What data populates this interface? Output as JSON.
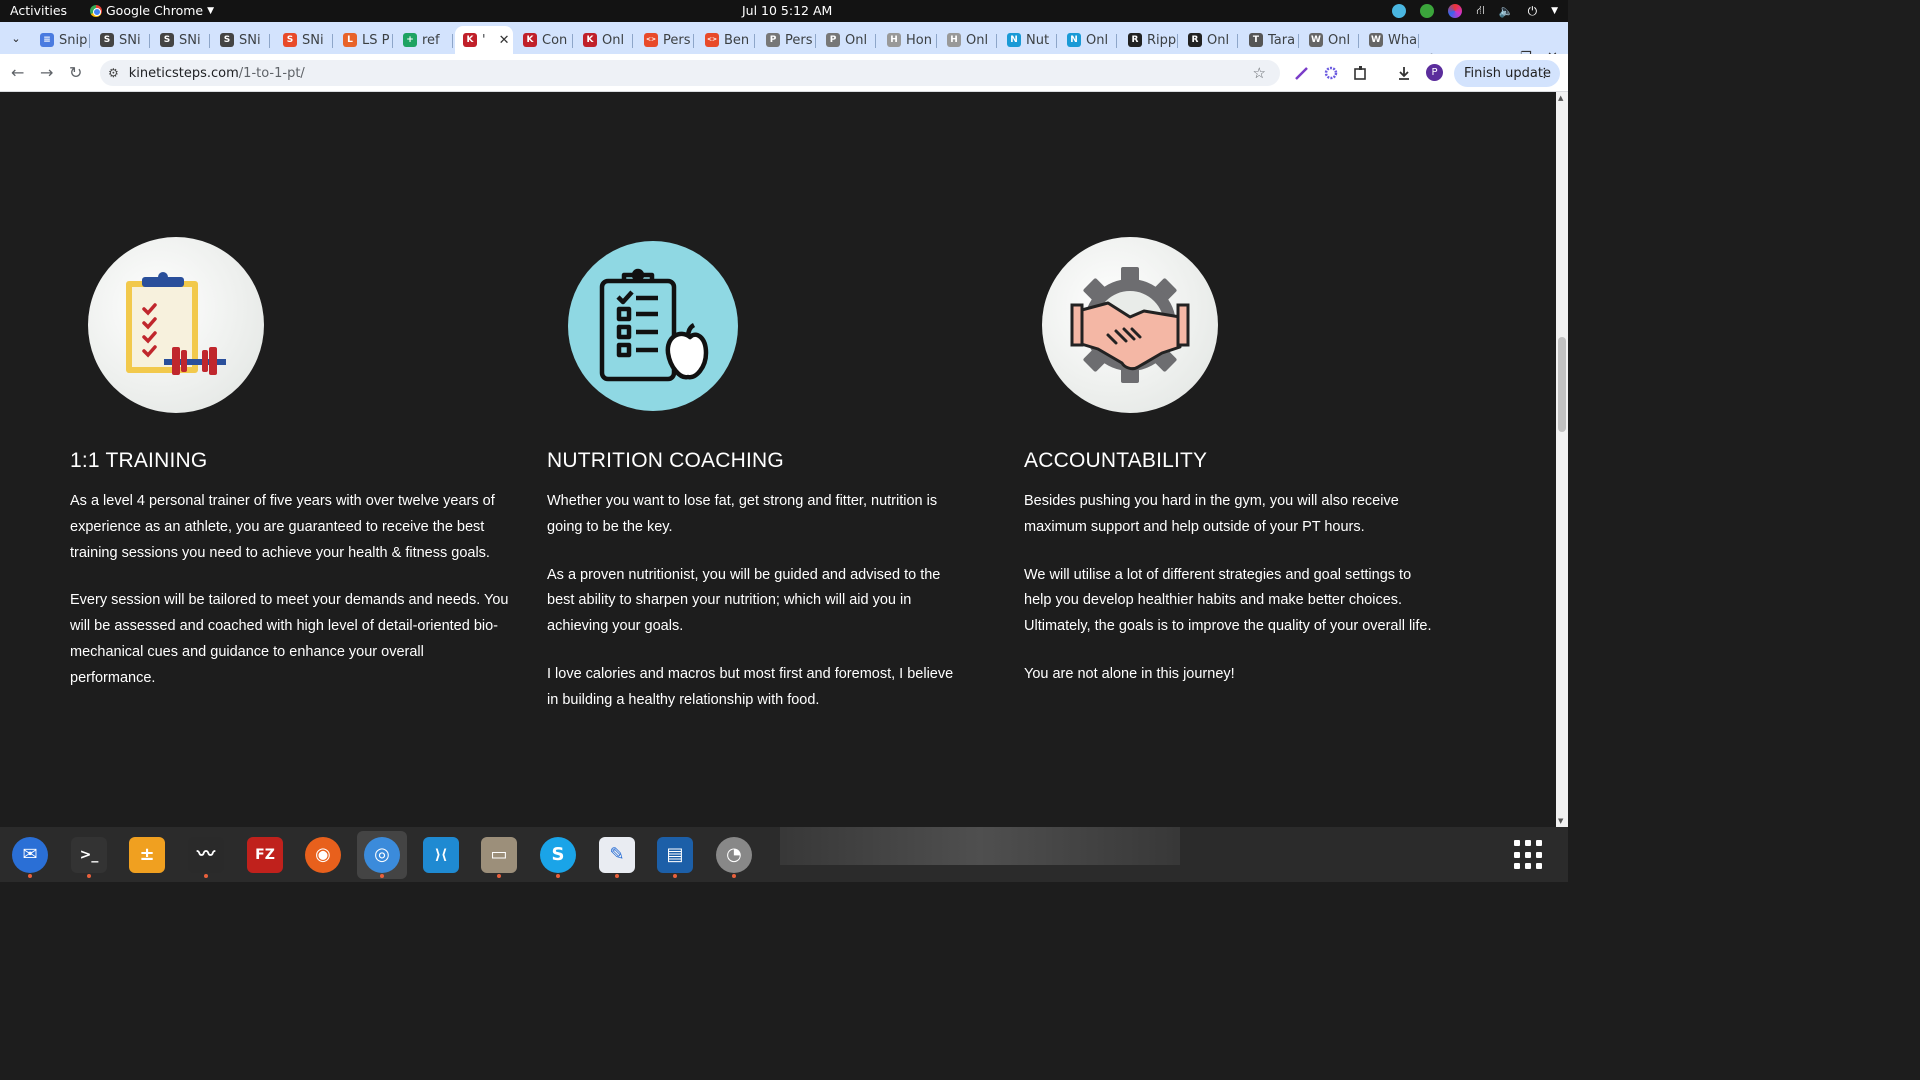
{
  "topbar": {
    "activities": "Activities",
    "app_name": "Google Chrome",
    "clock": "Jul 10  5:12 AM"
  },
  "tabs": [
    {
      "label": "Snip",
      "fav_color": "#4a7be0",
      "fav_glyph": "≡"
    },
    {
      "label": "SNi",
      "fav_color": "#444",
      "fav_glyph": "S"
    },
    {
      "label": "SNi",
      "fav_color": "#444",
      "fav_glyph": "S"
    },
    {
      "label": "SNi",
      "fav_color": "#444",
      "fav_glyph": "S"
    },
    {
      "label": "SNi",
      "fav_color": "#e84a2a",
      "fav_glyph": "S"
    },
    {
      "label": "LS P",
      "fav_color": "#e8632a",
      "fav_glyph": "L"
    },
    {
      "label": "ref",
      "fav_color": "#1ea362",
      "fav_glyph": "+"
    },
    {
      "label": "'",
      "fav_color": "#c0202a",
      "fav_glyph": "K",
      "active": true
    },
    {
      "label": "Con",
      "fav_color": "#c0202a",
      "fav_glyph": "K"
    },
    {
      "label": "Onl",
      "fav_color": "#c0202a",
      "fav_glyph": "K"
    },
    {
      "label": "Pers",
      "fav_color": "#e84a2a",
      "fav_glyph": "<>"
    },
    {
      "label": "Ben",
      "fav_color": "#e84a2a",
      "fav_glyph": "<>"
    },
    {
      "label": "Pers",
      "fav_color": "#777",
      "fav_glyph": "P"
    },
    {
      "label": "Onl",
      "fav_color": "#777",
      "fav_glyph": "P"
    },
    {
      "label": "Hon",
      "fav_color": "#999",
      "fav_glyph": "H"
    },
    {
      "label": "Onl",
      "fav_color": "#999",
      "fav_glyph": "H"
    },
    {
      "label": "Nut",
      "fav_color": "#1a9ad6",
      "fav_glyph": "N"
    },
    {
      "label": "Onl",
      "fav_color": "#1a9ad6",
      "fav_glyph": "N"
    },
    {
      "label": "Ripp",
      "fav_color": "#222",
      "fav_glyph": "R"
    },
    {
      "label": "Onl",
      "fav_color": "#222",
      "fav_glyph": "R"
    },
    {
      "label": "Tara",
      "fav_color": "#555",
      "fav_glyph": "T"
    },
    {
      "label": "Onl",
      "fav_color": "#666",
      "fav_glyph": "W"
    },
    {
      "label": "Wha",
      "fav_color": "#666",
      "fav_glyph": "W"
    }
  ],
  "toolbar": {
    "url_domain": "kineticsteps.com",
    "url_path": "/1-to-1-pt/",
    "finish_update": "Finish update",
    "avatar_letter": "P"
  },
  "features": [
    {
      "title": "1:1 TRAINING",
      "icon": "clipboard-dumbbell-icon",
      "paragraphs": [
        "As a level 4 personal trainer of five years with over twelve years of experience as an athlete, you are guaranteed to receive the best training sessions you need to achieve your health & fitness goals.",
        "Every session will be tailored to meet your demands and needs. You will be assessed and coached with high level of detail-oriented bio-mechanical cues and guidance to enhance your overall performance."
      ]
    },
    {
      "title": "NUTRITION COACHING",
      "icon": "checklist-apple-icon",
      "paragraphs": [
        "Whether you want to lose fat, get strong and fitter, nutrition is going to be the key.",
        "As a proven nutritionist, you will be guided and advised to the best ability to sharpen your nutrition; which will aid you in achieving your goals.",
        "I love calories and macros but most first and foremost,  I believe in building a healthy relationship with food."
      ]
    },
    {
      "title": "ACCOUNTABILITY",
      "icon": "handshake-gear-icon",
      "paragraphs": [
        "Besides pushing you hard in the gym, you will also receive maximum support and help outside of your PT hours.",
        "We will utilise a lot of different strategies and goal settings to help you develop healthier habits and make better choices. Ultimately, the goals is to improve the quality of your overall life.",
        "You are not alone in this journey!"
      ]
    }
  ],
  "dock": [
    {
      "name": "thunderbird",
      "color": "#2a6fd6",
      "glyph": "✉",
      "running": true
    },
    {
      "name": "terminal",
      "color": "#333",
      "glyph": ">_",
      "running": true
    },
    {
      "name": "calculator",
      "color": "#f0a020",
      "glyph": "±",
      "running": false
    },
    {
      "name": "system-monitor",
      "color": "#2a2a2a",
      "glyph": "〰",
      "running": true
    },
    {
      "name": "filezilla",
      "color": "#c0211c",
      "glyph": "FZ",
      "running": false
    },
    {
      "name": "firefox",
      "color": "#e8601c",
      "glyph": "◉",
      "running": false
    },
    {
      "name": "chrome",
      "color": "#3b8bdb",
      "glyph": "◎",
      "running": true,
      "active": true
    },
    {
      "name": "vscode",
      "color": "#1f8ad2",
      "glyph": "⟩⟨",
      "running": false
    },
    {
      "name": "files",
      "color": "#9c8f7a",
      "glyph": "▭",
      "running": true
    },
    {
      "name": "skype",
      "color": "#1aa4e8",
      "glyph": "S",
      "running": true
    },
    {
      "name": "text-editor",
      "color": "#e9ecf2",
      "glyph": "✎",
      "running": true
    },
    {
      "name": "writer",
      "color": "#1c5fa8",
      "glyph": "▤",
      "running": true
    },
    {
      "name": "disk-utility",
      "color": "#888",
      "glyph": "◔",
      "running": true
    }
  ]
}
